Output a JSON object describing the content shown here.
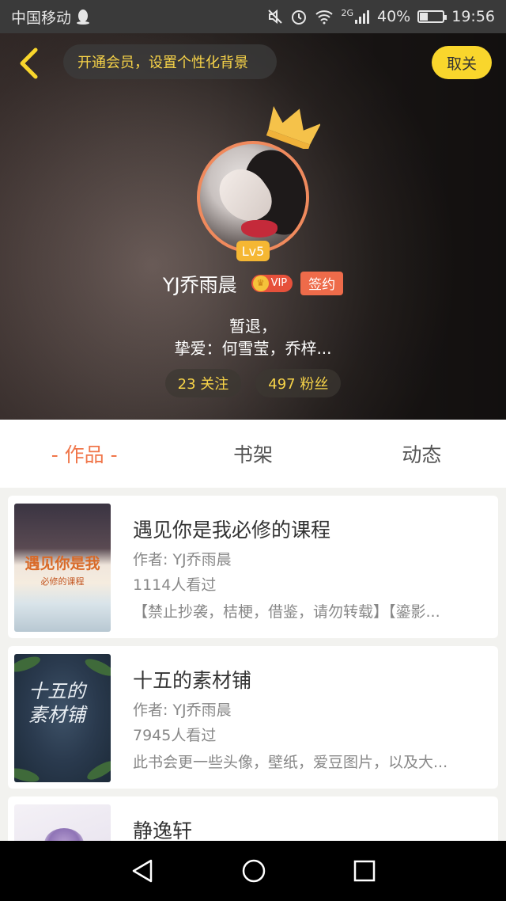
{
  "status_bar": {
    "carrier": "中国移动",
    "network": "2G",
    "battery": "40%",
    "battery_level": 0.4,
    "time": "19:56"
  },
  "header": {
    "vip_banner": "开通会员，设置个性化背景",
    "unfollow_label": "取关",
    "level": "Lv5",
    "username": "YJ乔雨晨",
    "vip_label": "VIP",
    "sign_label": "签约",
    "bio_line1": "暂退，",
    "bio_line2": "挚爱：何雪莹，乔梓...",
    "following": "23 关注",
    "followers": "497 粉丝"
  },
  "tabs": [
    {
      "label": "- 作品 -",
      "active": true
    },
    {
      "label": "书架",
      "active": false
    },
    {
      "label": "动态",
      "active": false
    }
  ],
  "books": [
    {
      "title": "遇见你是我必修的课程",
      "author": "作者: YJ乔雨晨",
      "views": "1114人看过",
      "desc": "【禁止抄袭，桔梗，借鉴，请勿转载】【鎏影...",
      "cover_title": "遇见你是我",
      "cover_subtitle": "必修的课程"
    },
    {
      "title": "十五的素材铺",
      "author": "作者: YJ乔雨晨",
      "views": "7945人看过",
      "desc": "此书会更一些头像，壁纸，爱豆图片，以及大...",
      "cover_title": "十五的素材铺"
    },
    {
      "title": "静逸轩"
    }
  ],
  "colors": {
    "accent": "#f0764a",
    "yellow": "#f9d62c",
    "gold_text": "#f7d348"
  }
}
